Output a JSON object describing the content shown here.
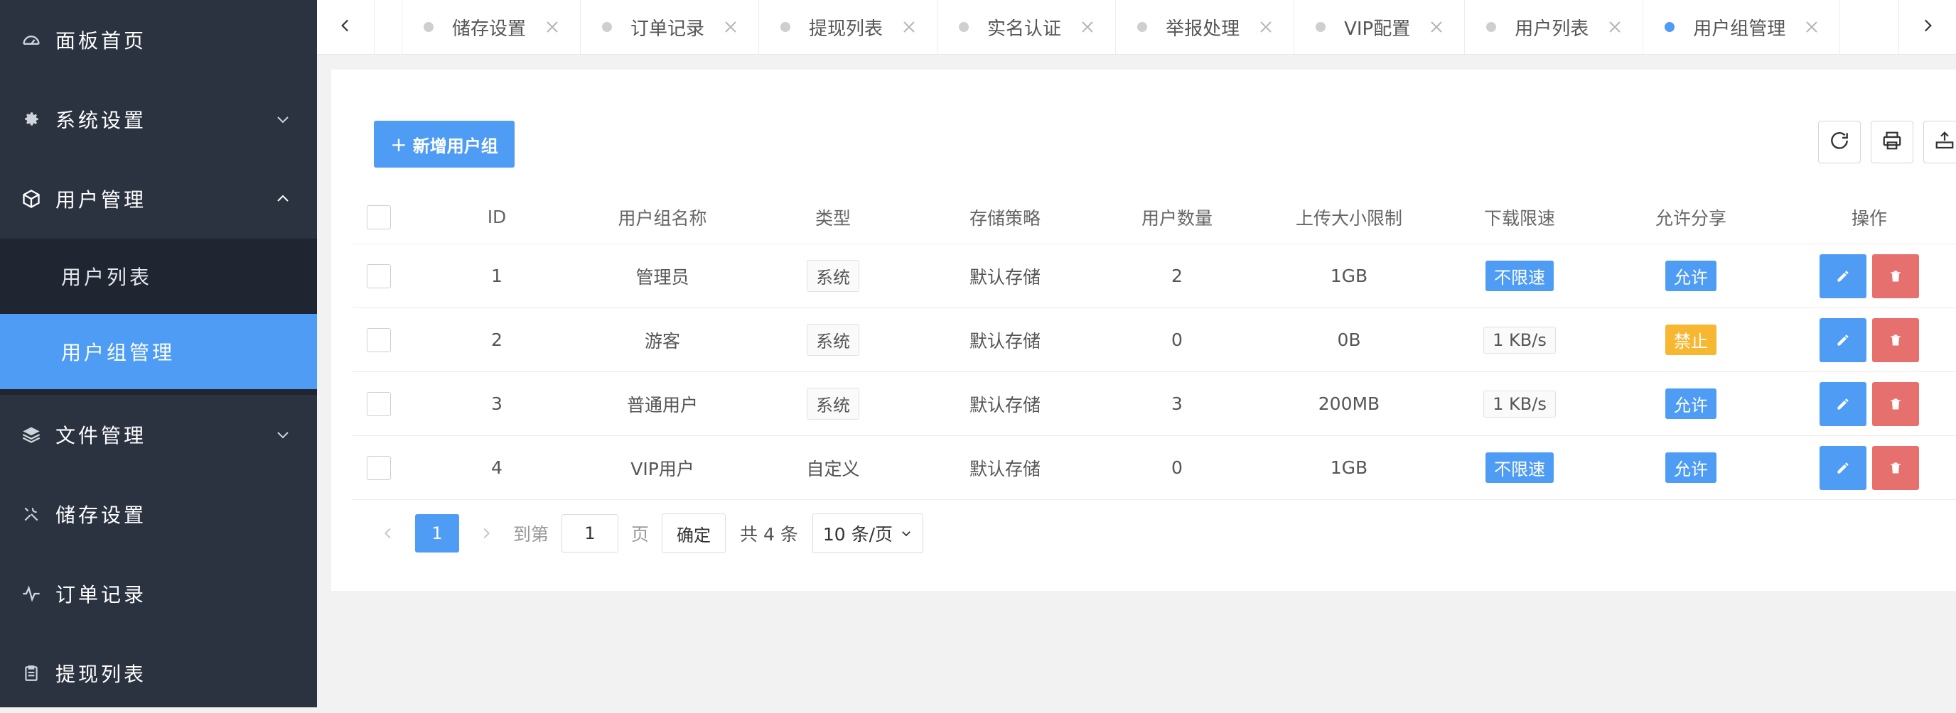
{
  "sidebar": {
    "items": [
      {
        "label": "面板首页",
        "icon": "dashboard-icon"
      },
      {
        "label": "系统设置",
        "icon": "gear-icon",
        "expanded": false
      },
      {
        "label": "用户管理",
        "icon": "cube-icon",
        "expanded": true,
        "children": [
          {
            "label": "用户列表"
          },
          {
            "label": "用户组管理",
            "active": true
          }
        ]
      },
      {
        "label": "文件管理",
        "icon": "layers-icon",
        "expanded": false
      },
      {
        "label": "储存设置",
        "icon": "tools-icon"
      },
      {
        "label": "订单记录",
        "icon": "pulse-icon"
      },
      {
        "label": "提现列表",
        "icon": "clipboard-icon"
      }
    ]
  },
  "tabs": [
    {
      "label": "储存设置"
    },
    {
      "label": "订单记录"
    },
    {
      "label": "提现列表"
    },
    {
      "label": "实名认证"
    },
    {
      "label": "举报处理"
    },
    {
      "label": "VIP配置"
    },
    {
      "label": "用户列表"
    },
    {
      "label": "用户组管理",
      "active": true
    }
  ],
  "toolbar": {
    "add_label": "新增用户组",
    "add_plus": "+"
  },
  "table": {
    "headers": {
      "id": "ID",
      "name": "用户组名称",
      "type": "类型",
      "storage": "存储策略",
      "count": "用户数量",
      "upload": "上传大小限制",
      "download": "下载限速",
      "share": "允许分享",
      "actions": "操作"
    },
    "rows": [
      {
        "id": "1",
        "name": "管理员",
        "type": "系统",
        "storage": "默认存储",
        "count": "2",
        "upload": "1GB",
        "download": "不限速",
        "share": "允许"
      },
      {
        "id": "2",
        "name": "游客",
        "type": "系统",
        "storage": "默认存储",
        "count": "0",
        "upload": "0B",
        "download": "1 KB/s",
        "share": "禁止"
      },
      {
        "id": "3",
        "name": "普通用户",
        "type": "系统",
        "storage": "默认存储",
        "count": "3",
        "upload": "200MB",
        "download": "1 KB/s",
        "share": "允许"
      },
      {
        "id": "4",
        "name": "VIP用户",
        "type": "自定义",
        "storage": "默认存储",
        "count": "0",
        "upload": "1GB",
        "download": "不限速",
        "share": "允许"
      }
    ]
  },
  "pagination": {
    "current": "1",
    "goto_label": "到第",
    "goto_value": "1",
    "page_label": "页",
    "confirm_label": "确定",
    "total_label": "共 4 条",
    "page_size": "10 条/页"
  },
  "colors": {
    "accent": "#4f9cf5",
    "danger": "#e6706e",
    "warning": "#f7b731",
    "sidebar": "#2b3240"
  }
}
